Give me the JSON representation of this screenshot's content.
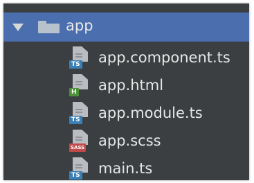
{
  "tree": {
    "root": {
      "label": "app",
      "expanded": true,
      "selected": true,
      "icon": "folder-icon"
    },
    "files": [
      {
        "label": "app.component.ts",
        "badge": "TS",
        "badge_color": "#3a7fb5",
        "icon": "typescript-file-icon"
      },
      {
        "label": "app.html",
        "badge": "H",
        "badge_color": "#4e8f3a",
        "icon": "html-file-icon"
      },
      {
        "label": "app.module.ts",
        "badge": "TS",
        "badge_color": "#3a7fb5",
        "icon": "typescript-file-icon"
      },
      {
        "label": "app.scss",
        "badge": "SASS",
        "badge_color": "#c24a4a",
        "icon": "scss-file-icon"
      },
      {
        "label": "main.ts",
        "badge": "TS",
        "badge_color": "#3a7fb5",
        "icon": "typescript-file-icon"
      }
    ]
  },
  "colors": {
    "panel_bg": "#3c3f41",
    "selection_bg": "#4b6eaf",
    "text": "#e6e6e6"
  }
}
